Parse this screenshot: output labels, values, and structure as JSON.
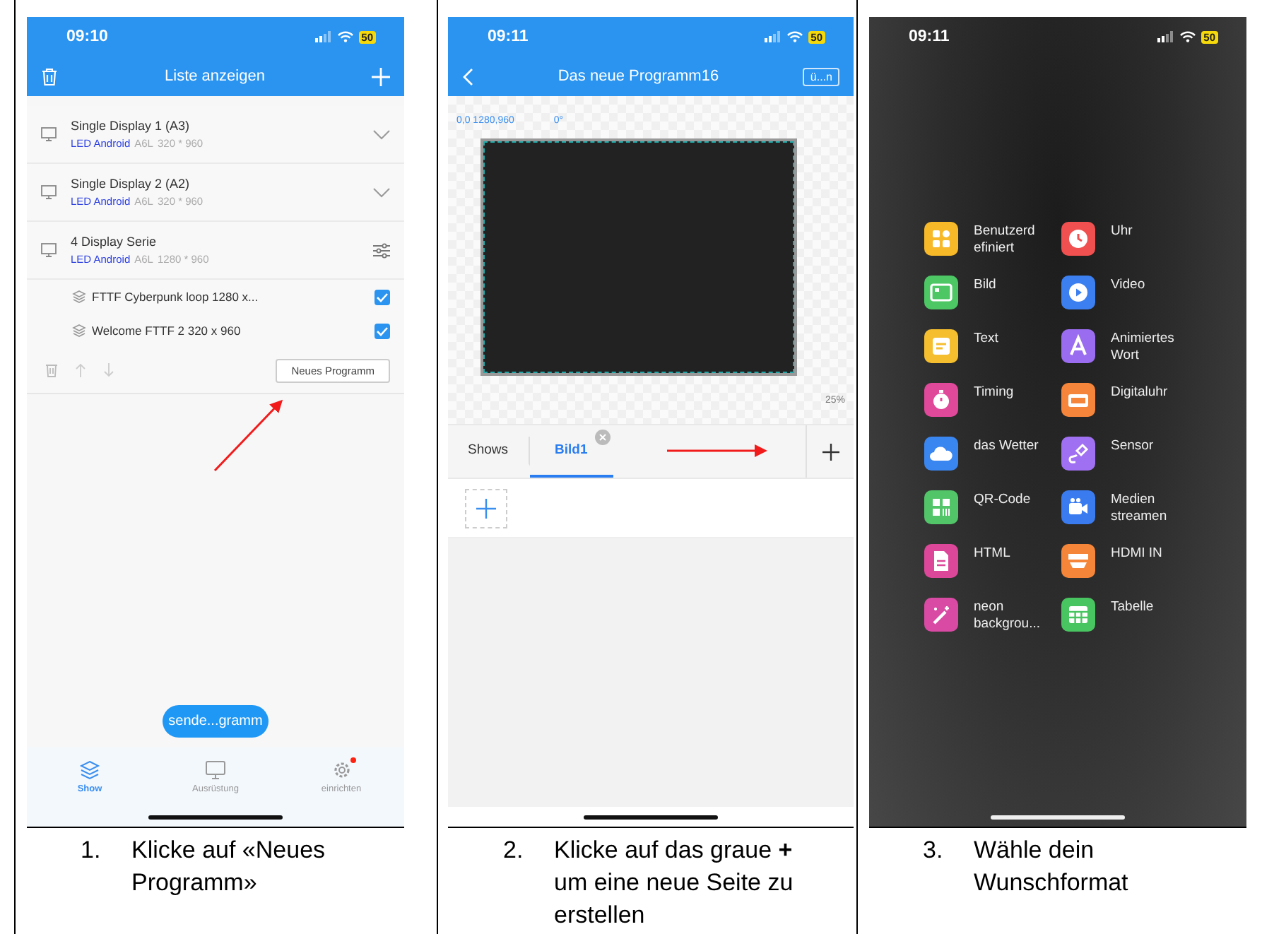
{
  "panels": [
    {
      "kind": "device_list",
      "status": {
        "time": "09:10",
        "battery": "50"
      },
      "header": {
        "title": "Liste anzeigen"
      },
      "devices": [
        {
          "name": "Single Display 1 (A3)",
          "type": "LED Android",
          "model": "A6L",
          "resolution": "320 * 960",
          "expanded": false
        },
        {
          "name": "Single Display 2 (A2)",
          "type": "LED Android",
          "model": "A6L",
          "resolution": "320 * 960",
          "expanded": false
        },
        {
          "name": "4 Display Serie",
          "type": "LED Android",
          "model": "A6L",
          "resolution": "1280 * 960",
          "expanded": true,
          "programs": [
            {
              "name": "FTTF Cyberpunk loop 1280 x...",
              "checked": true
            },
            {
              "name": "Welcome FTTF 2 320 x 960",
              "checked": true
            }
          ]
        }
      ],
      "new_program_button": "Neues Programm",
      "send_button": "sende...gramm",
      "nav": [
        {
          "label": "Show",
          "selected": true,
          "badge": false
        },
        {
          "label": "Ausrüstung",
          "selected": false,
          "badge": false
        },
        {
          "label": "einrichten",
          "selected": false,
          "badge": true
        }
      ]
    },
    {
      "kind": "editor",
      "status": {
        "time": "09:11",
        "battery": "50"
      },
      "header": {
        "title": "Das neue Programm16",
        "action": "ü...n"
      },
      "coords": "0,0 1280,960",
      "angle": "0°",
      "zoom": "25%",
      "tabs": [
        {
          "label": "Shows",
          "selected": false
        },
        {
          "label": "Bild1",
          "selected": true
        }
      ]
    },
    {
      "kind": "widget_menu",
      "status": {
        "time": "09:11",
        "battery": "50"
      },
      "items": [
        {
          "label": "Benutzerd efiniert",
          "color": "#f7b928"
        },
        {
          "label": "Uhr",
          "color": "#f0504f"
        },
        {
          "label": "Bild",
          "color": "#4cc764"
        },
        {
          "label": "Video",
          "color": "#3b7ff0"
        },
        {
          "label": "Text",
          "color": "#f5be2e"
        },
        {
          "label": "Animiertes Wort",
          "color": "#9a6cf0"
        },
        {
          "label": "Timing",
          "color": "#e0489a"
        },
        {
          "label": "Digitaluhr",
          "color": "#f5853a"
        },
        {
          "label": "das Wetter",
          "color": "#3a86f0"
        },
        {
          "label": "Sensor",
          "color": "#a070f2"
        },
        {
          "label": "QR-Code",
          "color": "#52c569"
        },
        {
          "label": "Medien streamen",
          "color": "#3a7cf0"
        },
        {
          "label": "HTML",
          "color": "#dc4799"
        },
        {
          "label": "HDMI IN",
          "color": "#f58538"
        },
        {
          "label": "neon backgrou...",
          "color": "#d94aa4"
        },
        {
          "label": "Tabelle",
          "color": "#48c460"
        }
      ]
    }
  ],
  "captions": [
    {
      "number": "1.",
      "text": "Klicke auf «Neues Programm»"
    },
    {
      "number": "2.",
      "text": "Klicke auf das graue **+** um eine neue Seite zu erstellen"
    },
    {
      "number": "3.",
      "text": "Wähle dein Wunschformat"
    }
  ]
}
